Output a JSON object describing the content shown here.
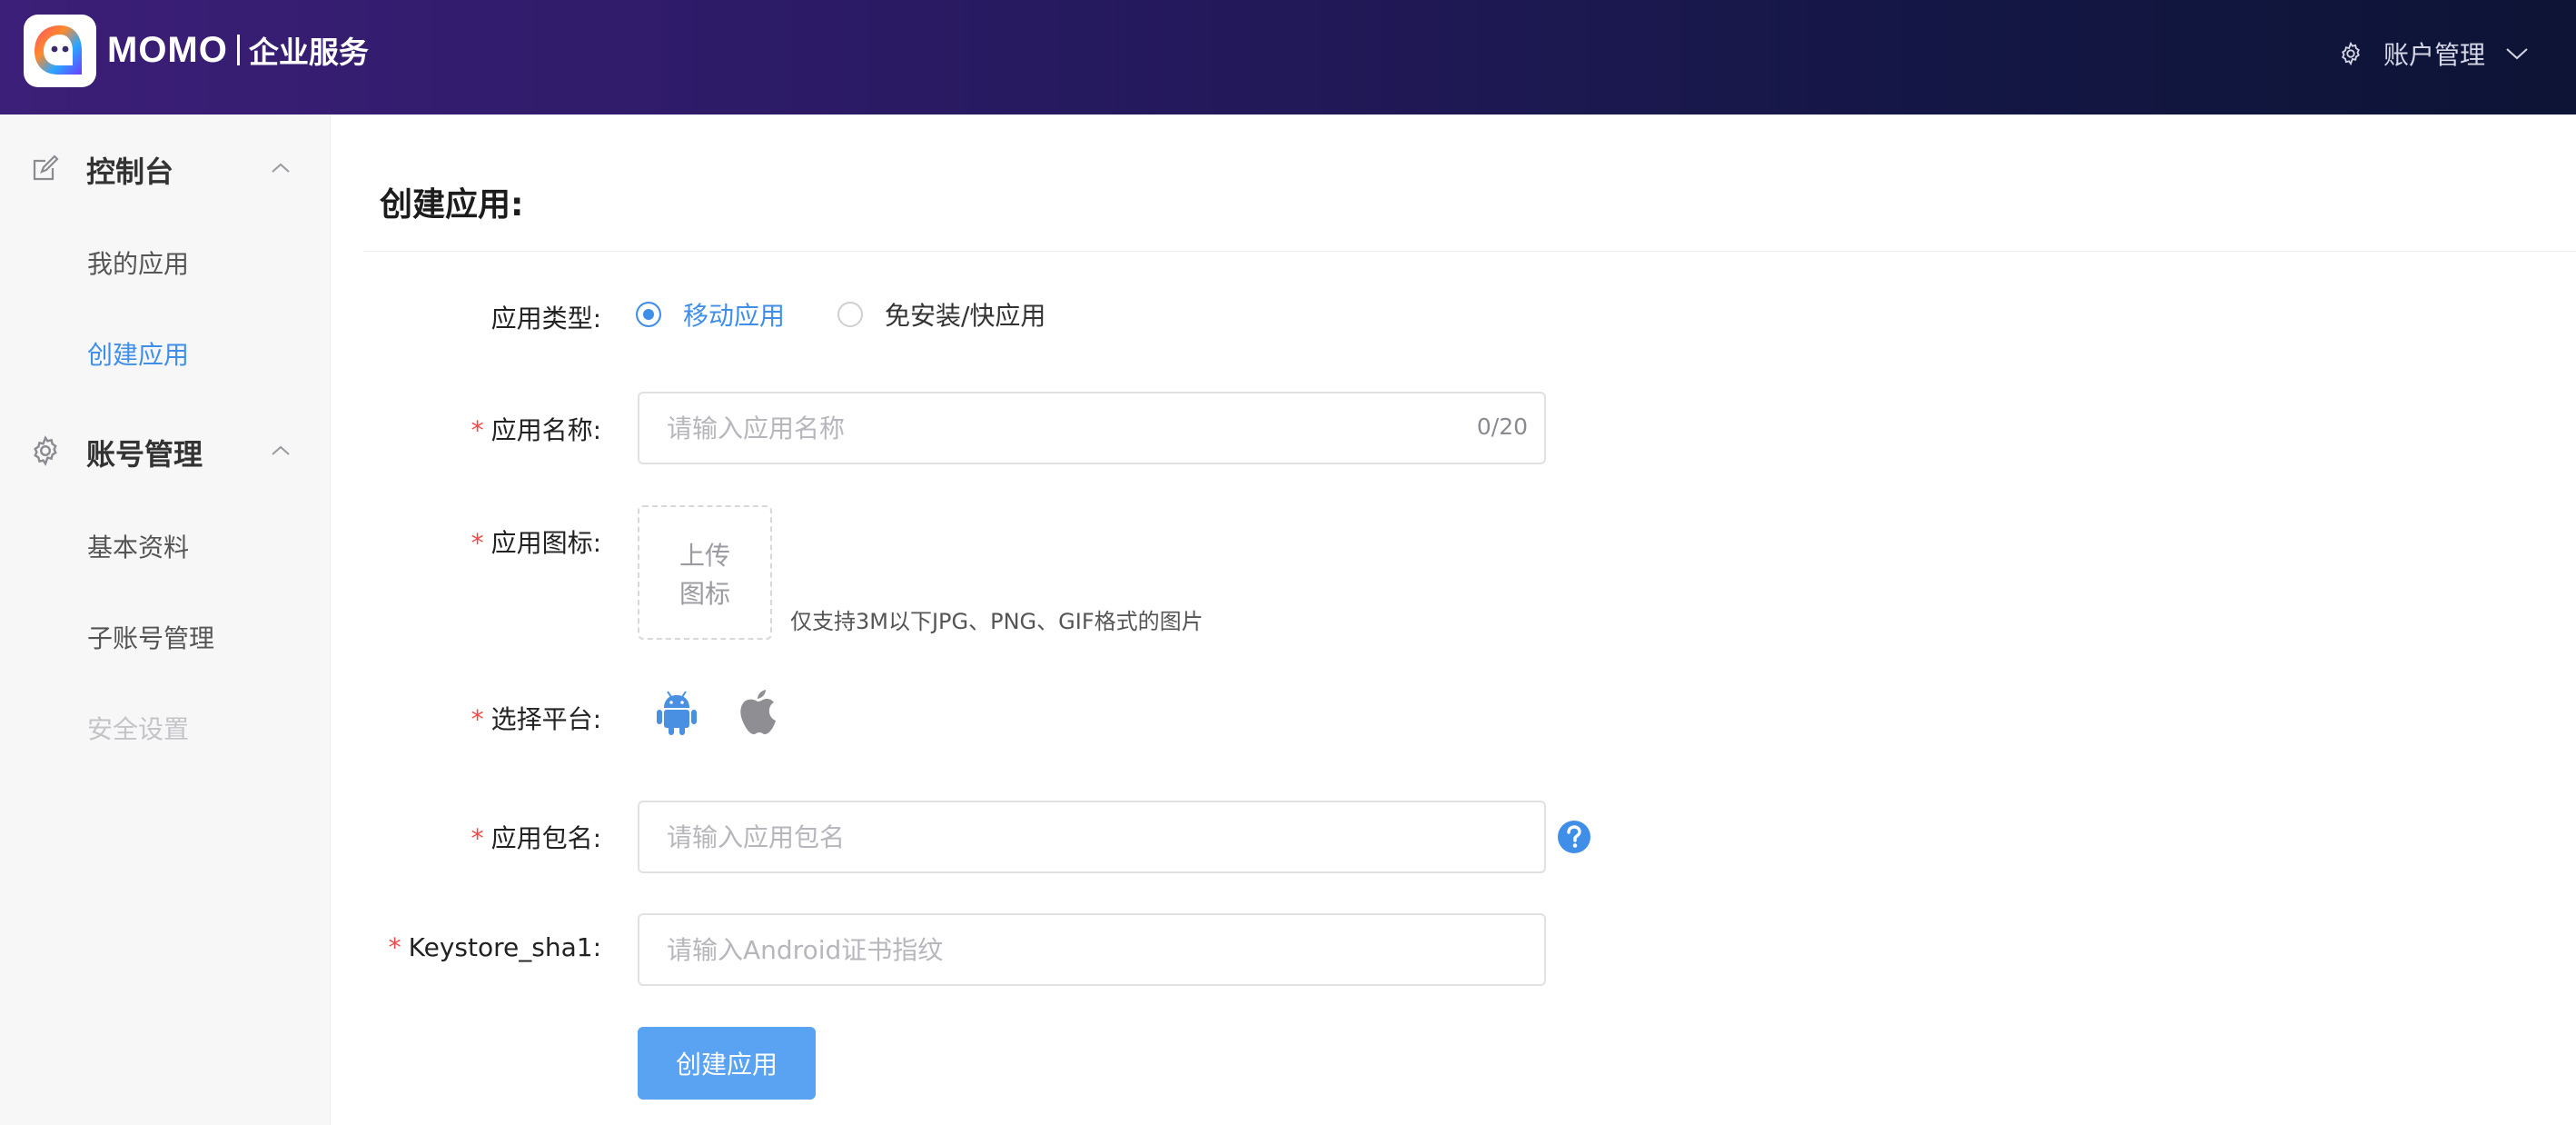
{
  "header": {
    "brand_name": "MOMO",
    "brand_sub": "企业服务",
    "account_menu_label": "账户管理"
  },
  "sidebar": {
    "groups": [
      {
        "title": "控制台",
        "icon": "edit-icon",
        "items": [
          {
            "label": "我的应用",
            "state": "normal"
          },
          {
            "label": "创建应用",
            "state": "active"
          }
        ]
      },
      {
        "title": "账号管理",
        "icon": "gear-icon",
        "items": [
          {
            "label": "基本资料",
            "state": "normal"
          },
          {
            "label": "子账号管理",
            "state": "normal"
          },
          {
            "label": "安全设置",
            "state": "disabled"
          }
        ]
      }
    ]
  },
  "main": {
    "title": "创建应用:",
    "form": {
      "app_type": {
        "label": "应用类型:",
        "options": [
          {
            "label": "移动应用",
            "checked": true
          },
          {
            "label": "免安装/快应用",
            "checked": false
          }
        ]
      },
      "app_name": {
        "label": "应用名称:",
        "required": "*",
        "value": "",
        "placeholder": "请输入应用名称",
        "counter": "0/20"
      },
      "app_icon": {
        "label": "应用图标:",
        "required": "*",
        "upload_line1": "上传",
        "upload_line2": "图标",
        "hint": "仅支持3M以下JPG、PNG、GIF格式的图片"
      },
      "platform": {
        "label": "选择平台:",
        "required": "*",
        "options": [
          {
            "icon": "android-icon",
            "selected": true
          },
          {
            "icon": "apple-icon",
            "selected": false
          }
        ]
      },
      "package_name": {
        "label": "应用包名:",
        "required": "*",
        "value": "",
        "placeholder": "请输入应用包名",
        "help_icon": "question-icon"
      },
      "keystore": {
        "label": "Keystore_sha1:",
        "required": "*",
        "value": "",
        "placeholder": "请输入Android证书指纹"
      },
      "submit_label": "创建应用"
    }
  },
  "colors": {
    "header_gradient_start": "#3c1f78",
    "header_gradient_end": "#0d1435",
    "accent": "#3f8ee8",
    "button": "#5aa3f3",
    "required_mark": "#f04848",
    "disabled_text": "#c4c4c8"
  }
}
